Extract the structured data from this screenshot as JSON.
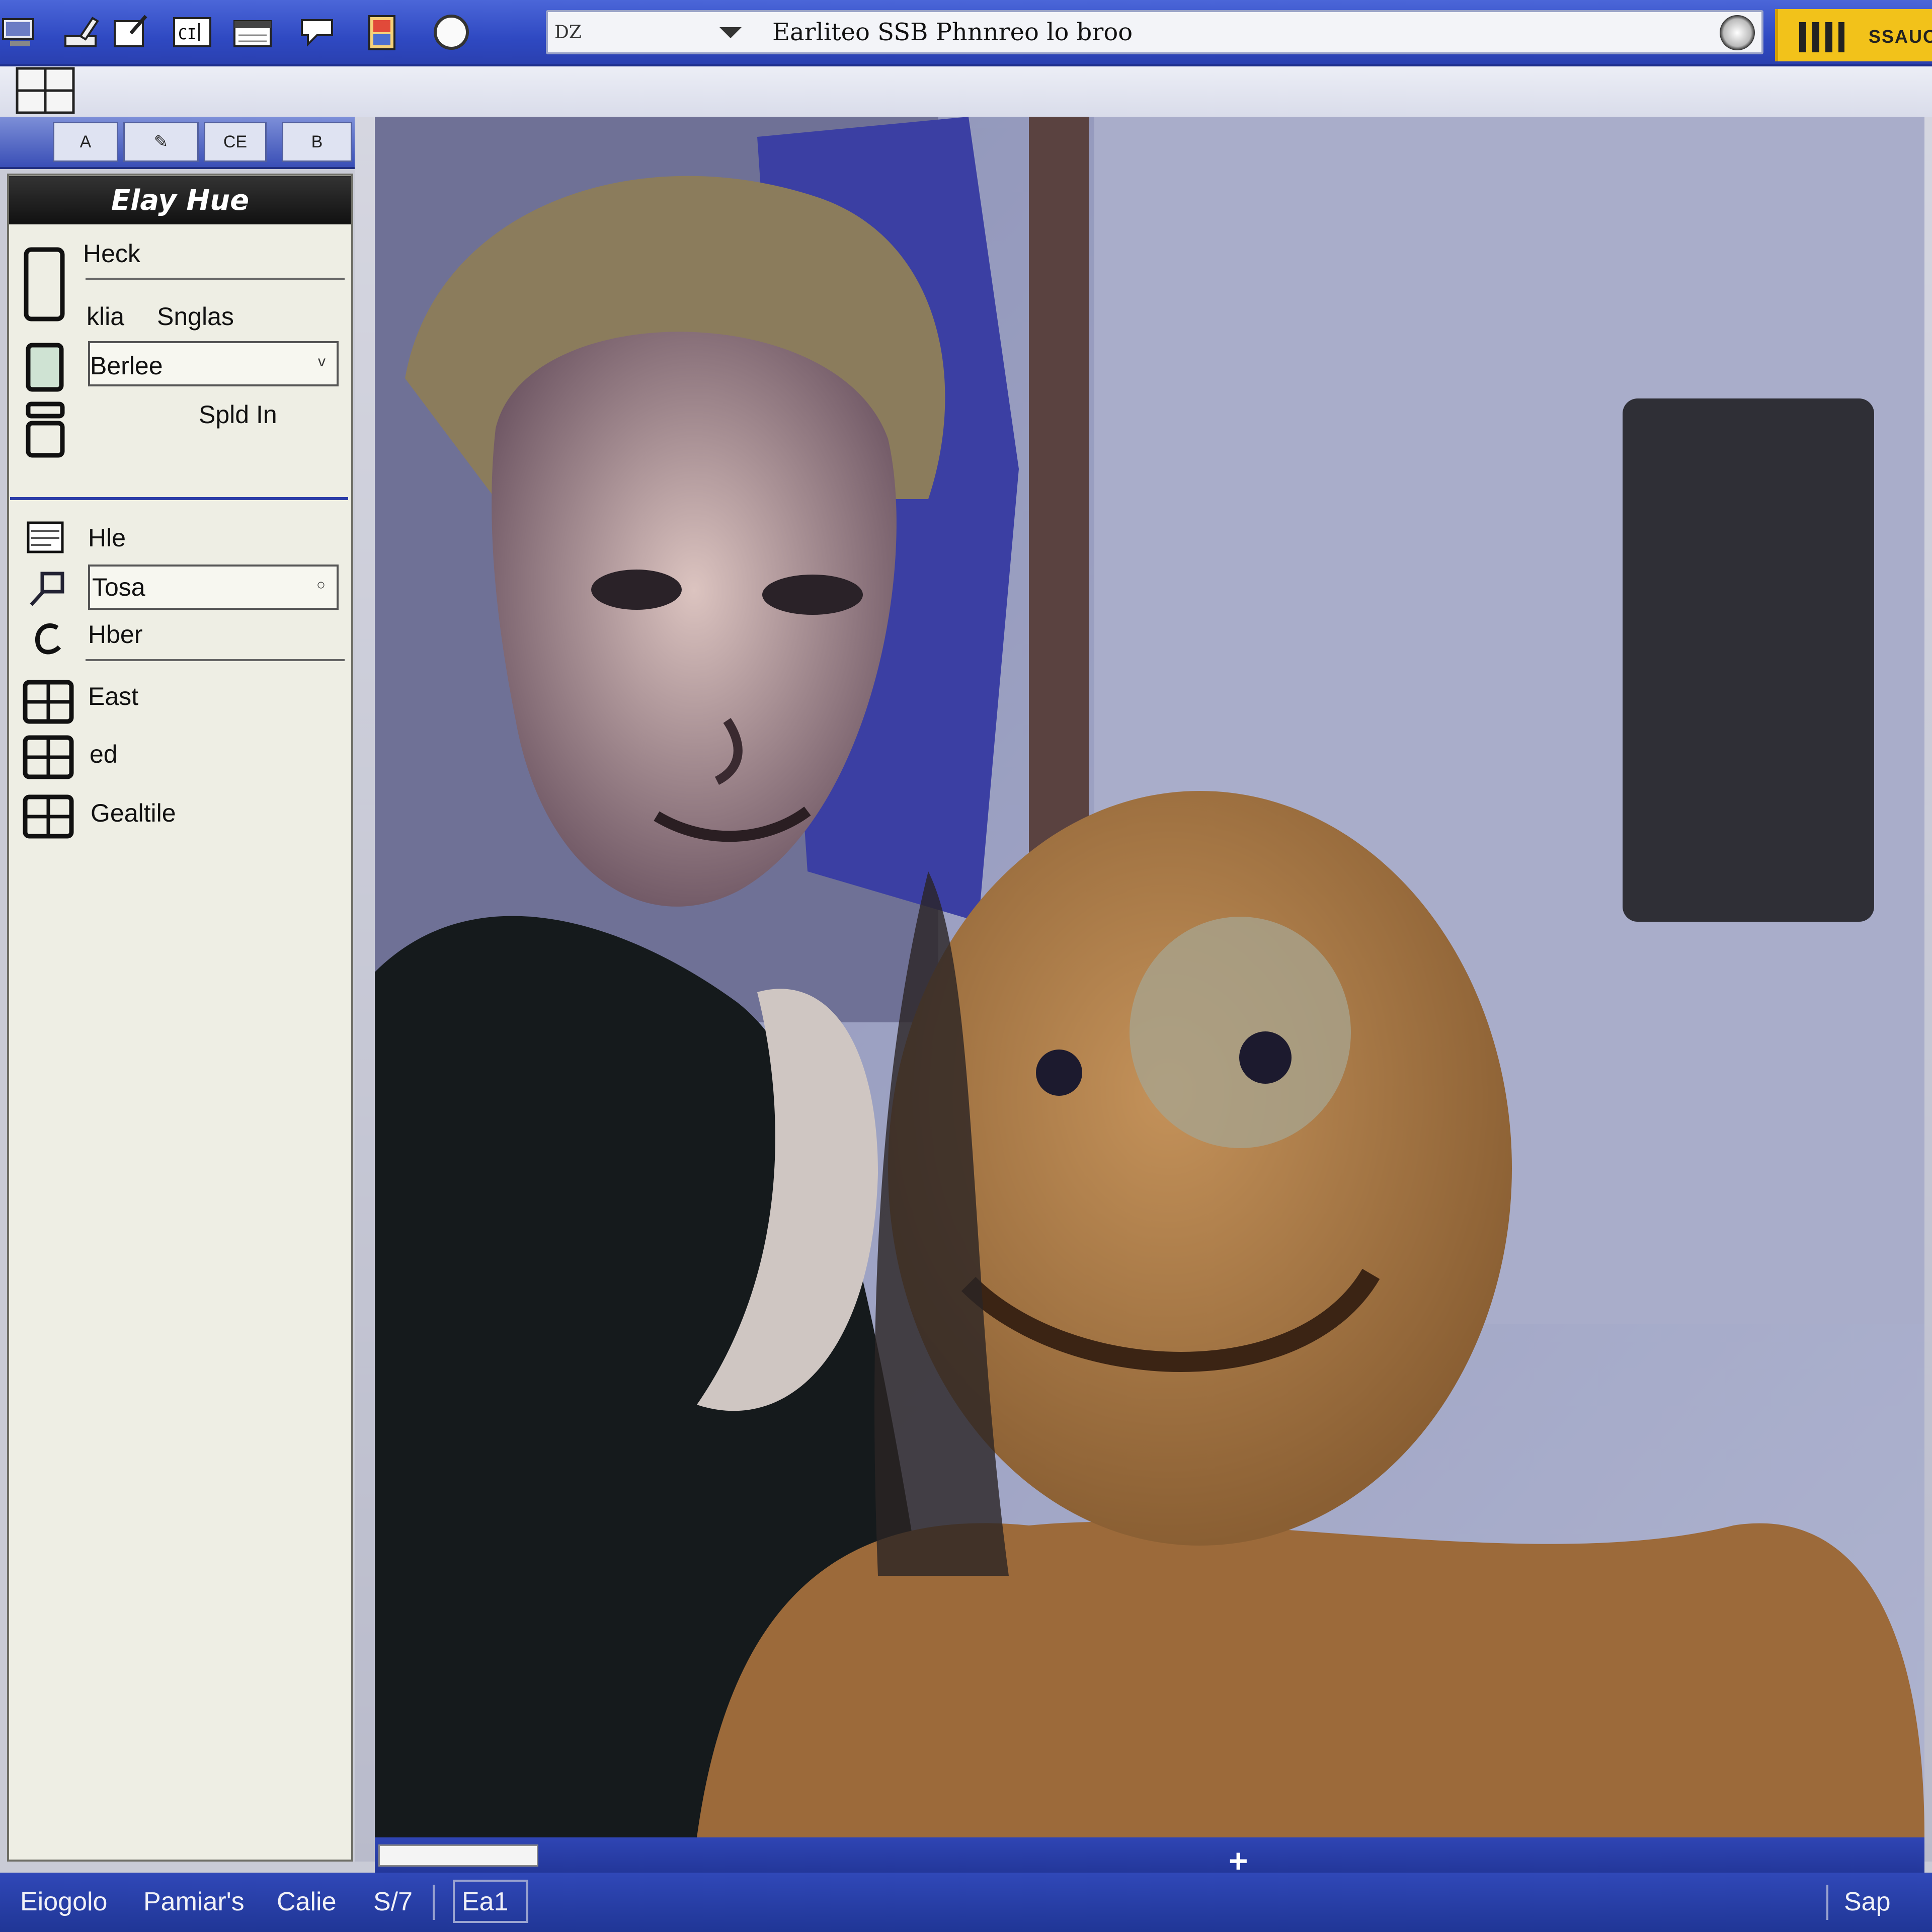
{
  "titlebar": {
    "address_prefix": "DZ",
    "address_text": "Earliteo SSB Phnnreo lo broo",
    "badge_label": "SSAUO"
  },
  "toolbar_icons": [
    "computer-icon",
    "pencil-icon",
    "edit-icon",
    "cut-icon",
    "calendar-icon",
    "mask-icon",
    "book-icon",
    "circle-icon"
  ],
  "left_toolbar": {
    "btn1": "A",
    "btn2": "CE",
    "btn3": "B"
  },
  "panel": {
    "header": "Elay Hue",
    "section1": {
      "heading": "Heck",
      "row_left": "klia",
      "row_right": "Snglas",
      "dropdown_value": "Berlee",
      "sub_label": "Spld In"
    },
    "section2": {
      "items": [
        "Hle",
        "Tosa",
        "Hber"
      ]
    },
    "section3": {
      "items": [
        "East",
        "ed",
        "Gealtile"
      ]
    }
  },
  "statusbar": {
    "item1": "Eiogolo",
    "item2": "Pamiar's",
    "item3": "Calie",
    "item4": "S/7",
    "item5": "Ea1",
    "item6": "Sap"
  },
  "colors": {
    "titlebar": "#2f49c2",
    "statusbar": "#203696",
    "panel": "#eeeee4",
    "badge": "#f2c21a"
  }
}
